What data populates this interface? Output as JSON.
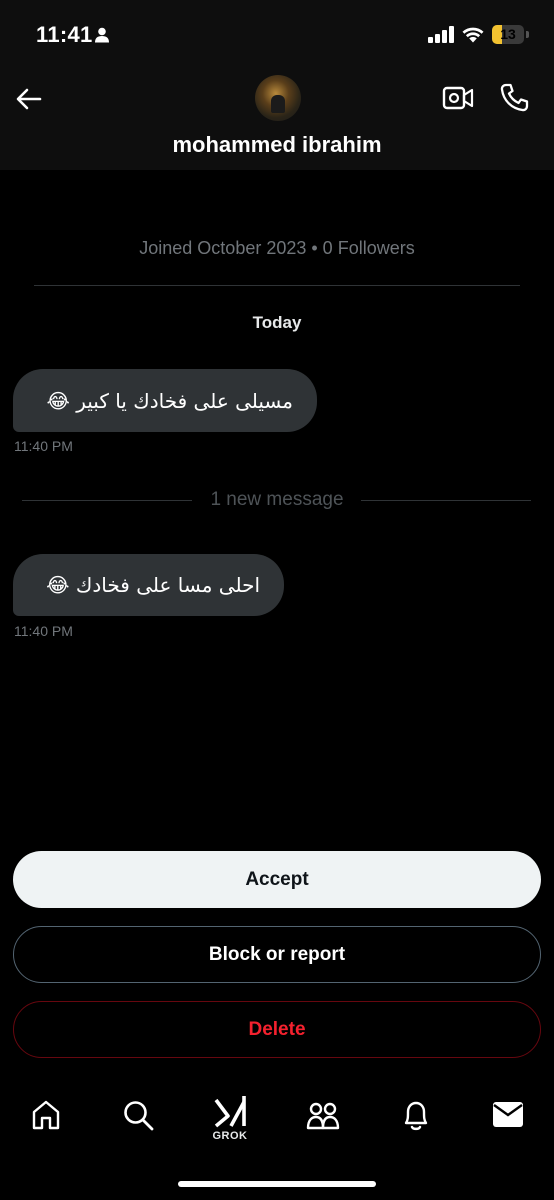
{
  "status_bar": {
    "time": "11:41",
    "battery_level": "13",
    "battery_fraction": 0.13,
    "icons": [
      "person-icon",
      "signal-icon",
      "wifi-icon",
      "battery-icon"
    ]
  },
  "header": {
    "name": "mohammed ibrahim",
    "icons": [
      "back-arrow-icon",
      "video-call-icon",
      "phone-icon"
    ]
  },
  "profile_info": "Joined October 2023 • 0 Followers",
  "date_label": "Today",
  "messages": [
    {
      "text": "مسيلى على فخادك يا كبير 😂",
      "time": "11:40 PM"
    },
    {
      "text": "احلى مسا على فخادك 😂",
      "time": "11:40 PM"
    }
  ],
  "new_message_divider": "1 new message",
  "actions": {
    "accept": "Accept",
    "block_or_report": "Block or report",
    "delete": "Delete"
  },
  "bottom_nav": {
    "grok_label": "GROK",
    "items": [
      "home-icon",
      "search-icon",
      "grok-icon",
      "communities-icon",
      "notifications-icon",
      "messages-icon"
    ]
  },
  "colors": {
    "background": "#000000",
    "bubble": "#2f3336",
    "accept_button": "#eff3f4",
    "delete_text": "#f4212e",
    "muted_text": "#71767b",
    "battery": "#f2c230"
  }
}
